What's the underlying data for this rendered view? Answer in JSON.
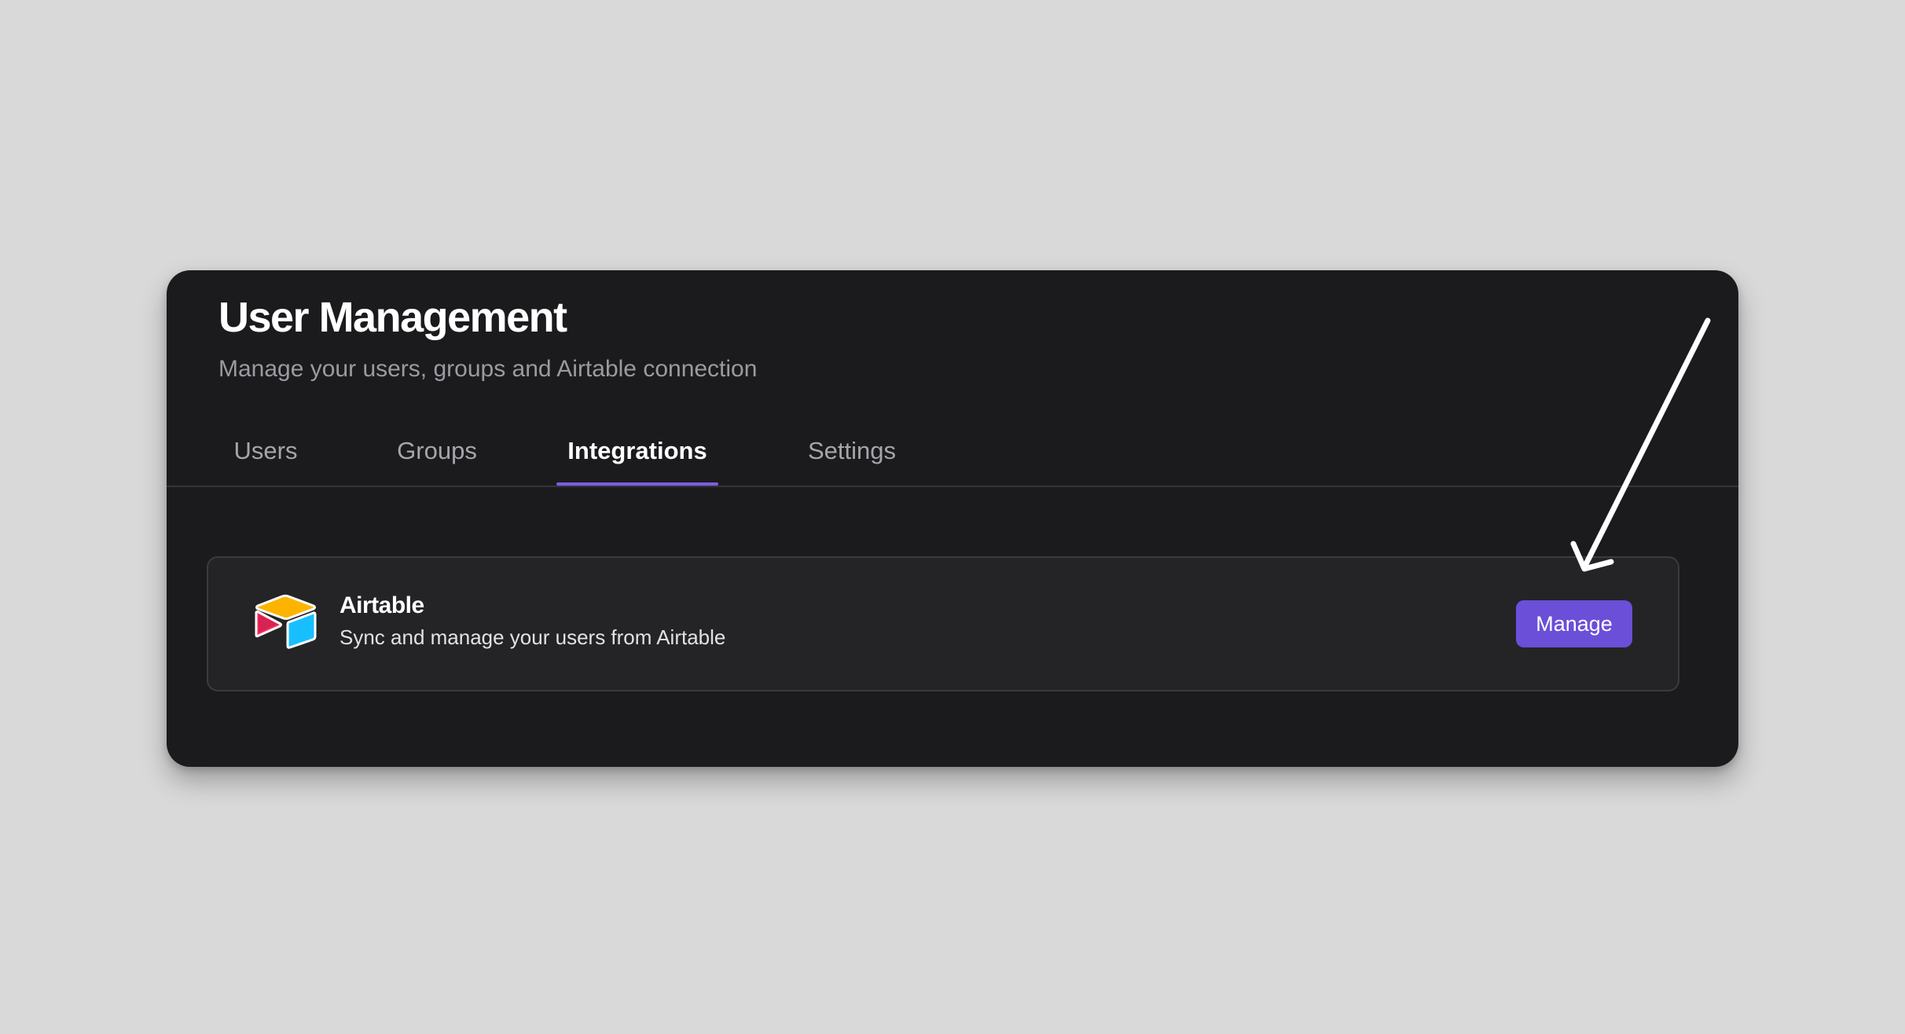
{
  "header": {
    "title": "User Management",
    "subtitle": "Manage your users, groups and Airtable connection"
  },
  "tabs": [
    {
      "label": "Users",
      "active": false
    },
    {
      "label": "Groups",
      "active": false
    },
    {
      "label": "Integrations",
      "active": true
    },
    {
      "label": "Settings",
      "active": false
    }
  ],
  "integration": {
    "name": "Airtable",
    "description": "Sync and manage your users from Airtable",
    "logo_icon": "airtable-logo-icon",
    "button_label": "Manage"
  },
  "annotation": {
    "icon": "arrow-pointer-icon"
  },
  "colors": {
    "page_background": "#d9d9d9",
    "panel_background": "#1b1b1d",
    "card_background": "#242427",
    "accent": "#7b5fe0",
    "button": "#6b4fd8",
    "airtable_yellow": "#fcb400",
    "airtable_blue": "#18bfff",
    "airtable_red": "#f82b60"
  }
}
